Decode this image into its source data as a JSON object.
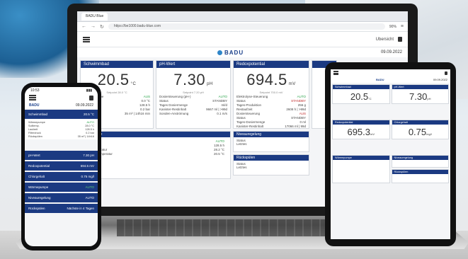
{
  "browser": {
    "tab_label": "BADU Blue",
    "url": "https://be1000.badu-blue.com",
    "zoom": "90%"
  },
  "app": {
    "user_label": "Ubersicht",
    "brand": "BADU",
    "date": "09.09.2022"
  },
  "laptop_cards": [
    {
      "title": "Schwimmbad",
      "value": "20.5",
      "unit": "°C",
      "sub": "Setpoint 28.0 °C",
      "rows": [
        {
          "k": "Wärmepumpe",
          "v": "AUS"
        },
        {
          "k": "Niveau",
          "v": "0.0 °C"
        },
        {
          "k": "Laufzeit",
          "v": "128.5 h"
        },
        {
          "k": "Filterbrücke",
          "v": "0.2 bar"
        },
        {
          "k": "Rückspülen",
          "v": "35 m³ | 14h16 min"
        }
      ]
    },
    {
      "title": "pH-Wert",
      "value": "7.30",
      "unit": "pH",
      "sub": "Setpoint 7.20 pH",
      "rows": [
        {
          "k": "Dosiersteuerung (pH-)",
          "v": "AUTO"
        },
        {
          "k": "Status",
          "v": "STANDBY"
        },
        {
          "k": "Tages Dosiermenge",
          "v": "ml/d"
        },
        {
          "k": "Kanister-Restinhalt",
          "v": "9667 ml | >99d"
        },
        {
          "k": "Sonden-Anströmung",
          "v": "0.1 m/s"
        }
      ]
    },
    {
      "title": "Redoxpotential",
      "value": "694.5",
      "unit": "mV",
      "sub": "Setpoint 700.0 mV",
      "rows": [
        {
          "k": "Elektrolyse-Steuerung",
          "v": "AUTO"
        },
        {
          "k": "Status",
          "v": "STANDBY"
        },
        {
          "k": "Tages-Produktion",
          "v": "256 g"
        },
        {
          "k": "Restaufzeit",
          "v": "2608 h | >99d"
        },
        {
          "k": "Dosiersteuerung",
          "v": "AUS"
        },
        {
          "k": "Status",
          "v": "STANDBY"
        },
        {
          "k": "Tages-Dosiermenge",
          "v": "0 ml"
        },
        {
          "k": "Kanister-Restinhalt",
          "v": "17066 ml | 99d"
        }
      ]
    }
  ],
  "laptop_panel_pump": {
    "title": "Filterpumpe",
    "rows": [
      {
        "k": "Status",
        "v": "AUTO"
      },
      {
        "k": "Laufzeit",
        "v": "128.5 h"
      },
      {
        "k": "Solltemperatur",
        "v": "28.2 °C"
      },
      {
        "k": "Wassertemperatur",
        "v": "20.5 °C"
      }
    ]
  },
  "laptop_panel_level": {
    "title": "Niveauregelung",
    "rows": [
      {
        "k": "Status",
        "v": ""
      },
      {
        "k": "Letztes",
        "v": ""
      }
    ]
  },
  "laptop_panel_backwash": {
    "title": "Rückspülen",
    "rows": [
      {
        "k": "Status",
        "v": ""
      },
      {
        "k": "Letztes",
        "v": ""
      }
    ]
  },
  "phone": {
    "time": "10:53",
    "date": "09.09.2022",
    "brand": "BADU",
    "items": [
      {
        "label": "Schwimmbad",
        "value": "20.5 °C"
      },
      {
        "label": "pH-Wert",
        "value": "7.30 pH"
      },
      {
        "label": "Redoxpotential",
        "value": "694.5 mV"
      },
      {
        "label": "Chlorgehalt",
        "value": "0.75 mg/l"
      },
      {
        "label": "Wärmepumpe",
        "value": "AUTO"
      },
      {
        "label": "Niveauregelung",
        "value": "AUTO"
      },
      {
        "label": "Rückspülen",
        "value": "Nächste in 4 Tagen"
      }
    ],
    "detail_rows": [
      {
        "k": "Wärmepumpe",
        "v": "AUTO"
      },
      {
        "k": "Solltemp.",
        "v": "28.0 °C"
      },
      {
        "k": "Laufzeit",
        "v": "128.5 h"
      },
      {
        "k": "Filterdruck",
        "v": "0.2 bar"
      },
      {
        "k": "Rückspülen",
        "v": "35 m³ | 14h16"
      }
    ]
  },
  "tablet": {
    "brand": "BADU",
    "date": "09.09.2022",
    "cards": [
      {
        "title": "Schwimmbad",
        "value": "20.5",
        "unit": "°C"
      },
      {
        "title": "pH-Wert",
        "value": "7.30",
        "unit": "pH"
      },
      {
        "title": "Redoxpotential",
        "value": "695.3",
        "unit": "mV"
      },
      {
        "title": "Chlorgehalt",
        "value": "0.75",
        "unit": "mg/l"
      }
    ],
    "bottom": [
      {
        "title": "Wärmepumpe"
      },
      {
        "title": "Niveauregelung"
      },
      {
        "title": "Rückspülen"
      }
    ]
  }
}
